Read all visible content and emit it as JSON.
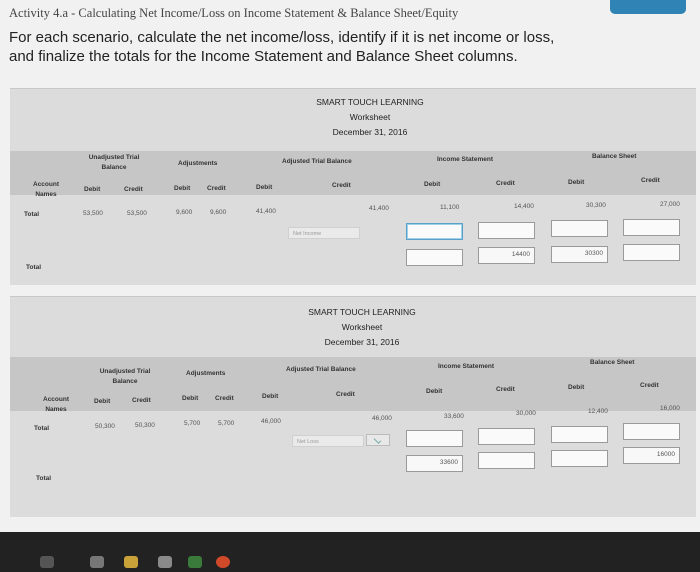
{
  "header": {
    "activity_title": "Activity 4.a - Calculating Net Income/Loss on Income Statement & Balance Sheet/Equity",
    "prompt": "For each scenario, calculate the net income/loss, identify if it is net income or loss, and finalize the totals for the Income Statement and Balance Sheet columns."
  },
  "worksheet1": {
    "company": "SMART TOUCH LEARNING",
    "doc": "Worksheet",
    "date": "December 31, 2016",
    "groups": {
      "unadjusted": "Unadjusted Trial Balance",
      "adjustments": "Adjustments",
      "adjusted": "Adjusted Trial Balance",
      "income": "Income Statement",
      "balance": "Balance Sheet"
    },
    "account_names": "Account Names",
    "debit": "Debit",
    "credit": "Credit",
    "total_label": "Total",
    "values": {
      "utb_debit": "53,500",
      "utb_credit": "53,500",
      "adj_debit": "9,600",
      "adj_credit": "9,600",
      "atb_debit": "41,400",
      "atb_credit": "41,400",
      "is_debit": "11,100",
      "is_credit": "14,400",
      "bs_debit": "30,300",
      "bs_credit": "27,000"
    },
    "net_placeholder": "Net Income",
    "final_is_credit": "14400",
    "final_bs_debit": "30300"
  },
  "worksheet2": {
    "company": "SMART TOUCH LEARNING",
    "doc": "Worksheet",
    "date": "December 31, 2016",
    "groups": {
      "unadjusted": "Unadjusted Trial Balance",
      "adjustments": "Adjustments",
      "adjusted": "Adjusted Trial Balance",
      "income": "Income Statement",
      "balance": "Balance Sheet"
    },
    "account_names": "Account Names",
    "debit": "Debit",
    "credit": "Credit",
    "total_label": "Total",
    "values": {
      "utb_debit": "50,300",
      "utb_credit": "50,300",
      "adj_debit": "5,700",
      "adj_credit": "5,700",
      "atb_debit": "46,000",
      "atb_credit": "46,000",
      "is_debit": "33,600",
      "is_credit": "30,000",
      "bs_debit": "12,400",
      "bs_credit": "16,000"
    },
    "net_placeholder": "Net Loss",
    "final_is_debit": "33600",
    "final_bs_credit": "16000"
  }
}
